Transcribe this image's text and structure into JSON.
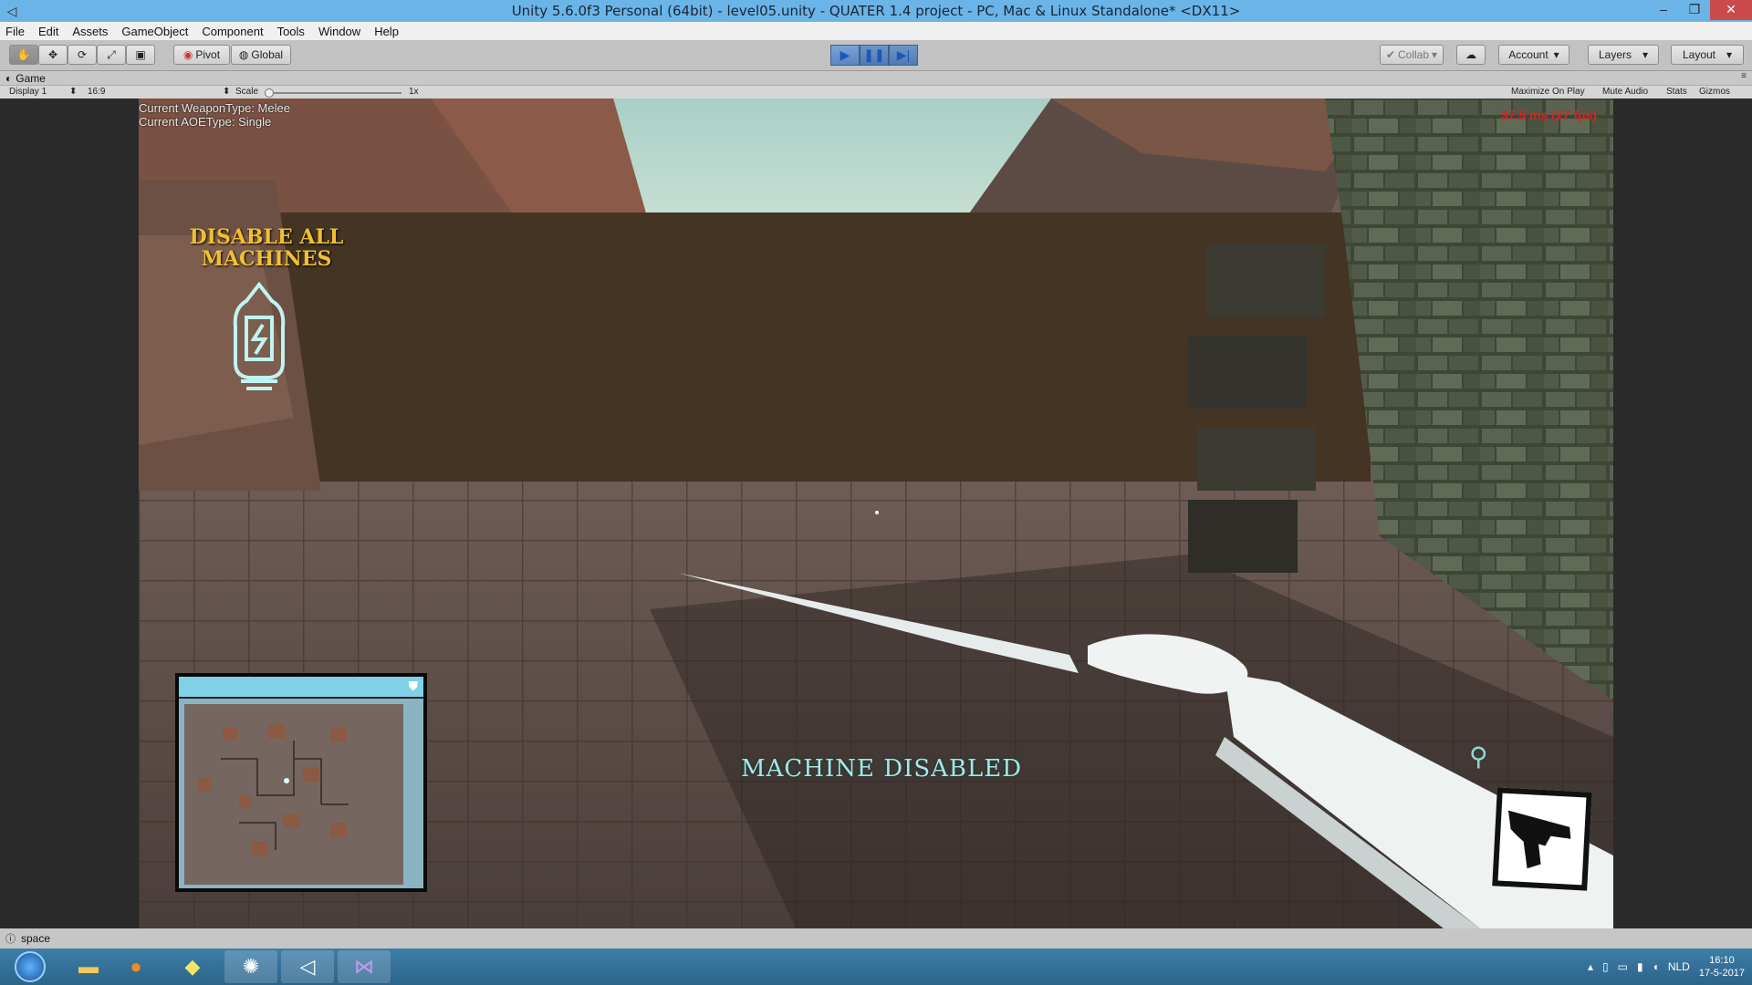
{
  "window": {
    "title": "Unity 5.6.0f3 Personal (64bit) - level05.unity - QUATER 1.4 project - PC, Mac & Linux Standalone* <DX11>"
  },
  "menu": [
    "File",
    "Edit",
    "Assets",
    "GameObject",
    "Component",
    "Tools",
    "Window",
    "Help"
  ],
  "toolbar": {
    "pivot": "Pivot",
    "global": "Global",
    "collab": "Collab",
    "account": "Account",
    "layers": "Layers",
    "layout": "Layout"
  },
  "game_tab": {
    "label": "Game",
    "display": "Display 1",
    "aspect": "16:9",
    "scale_label": "Scale",
    "scale_value": "1x",
    "maximize": "Maximize On Play",
    "mute": "Mute Audio",
    "stats": "Stats",
    "gizmos": "Gizmos"
  },
  "hud": {
    "weapon_type": "Current WeaponType: Melee",
    "aoe_type": "Current AOEType: Single",
    "fps": "37.5 ms (27 fps)",
    "objective": "DISABLE ALL MACHINES",
    "message": "MACHINE DISABLED"
  },
  "statusbar": {
    "text": "space"
  },
  "taskbar": {
    "language": "NLD",
    "time": "16:10",
    "date": "17-5-2017"
  },
  "colors": {
    "title_bg": "#6bb4e8",
    "objective": "#f0c030",
    "message": "#a9e6e2",
    "fps": "#e02020"
  }
}
